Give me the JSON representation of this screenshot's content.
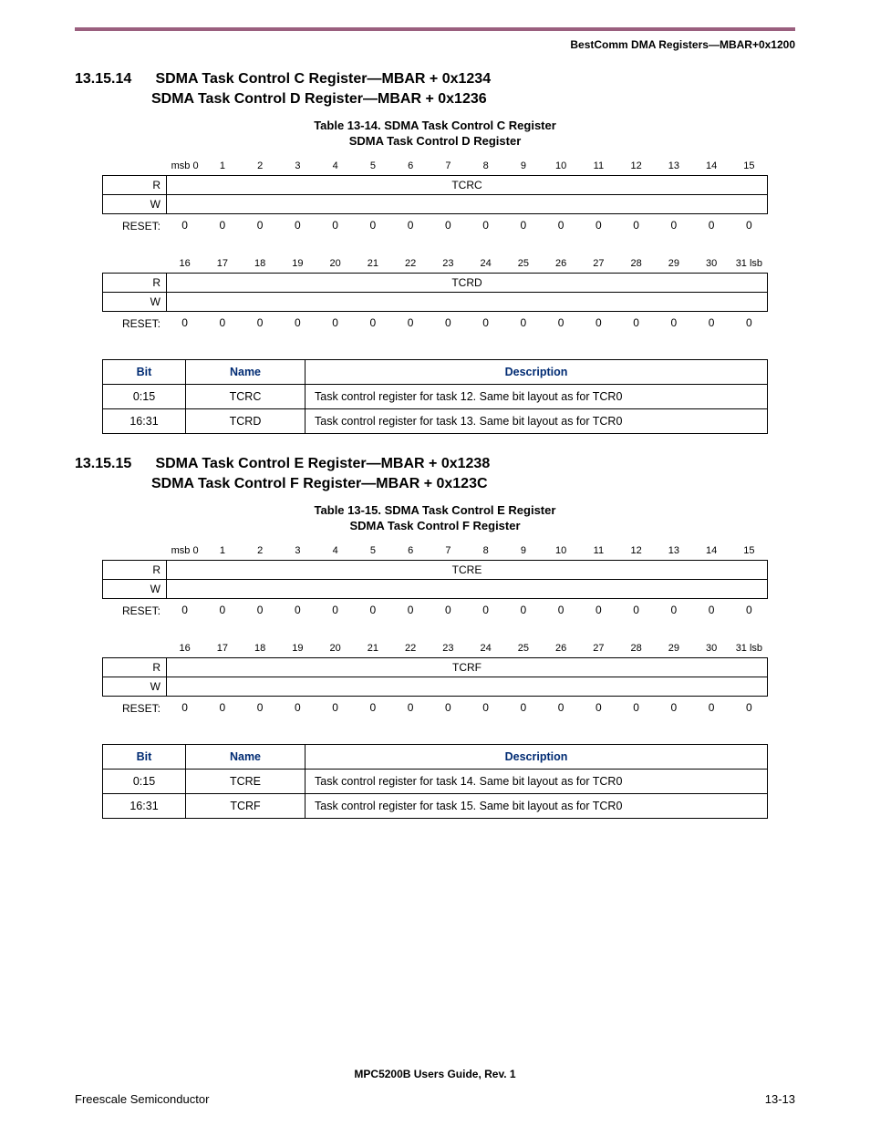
{
  "running_header": "BestComm DMA Registers—MBAR+0x1200",
  "footer_center": "MPC5200B Users Guide, Rev. 1",
  "footer_left": "Freescale Semiconductor",
  "footer_right": "13-13",
  "section1": {
    "number": "13.15.14",
    "line1": "SDMA Task Control C Register—MBAR + 0x1234",
    "line2": "SDMA Task Control D Register—MBAR + 0x1236",
    "caption_line1": "Table 13-14. SDMA Task Control C Register",
    "caption_line2": "SDMA Task Control D Register",
    "layout": {
      "row1_headers": [
        "msb 0",
        "1",
        "2",
        "3",
        "4",
        "5",
        "6",
        "7",
        "8",
        "9",
        "10",
        "11",
        "12",
        "13",
        "14",
        "15"
      ],
      "row1_field": "TCRC",
      "row1_reset": [
        "0",
        "0",
        "0",
        "0",
        "0",
        "0",
        "0",
        "0",
        "0",
        "0",
        "0",
        "0",
        "0",
        "0",
        "0",
        "0"
      ],
      "row2_headers": [
        "16",
        "17",
        "18",
        "19",
        "20",
        "21",
        "22",
        "23",
        "24",
        "25",
        "26",
        "27",
        "28",
        "29",
        "30",
        "31 lsb"
      ],
      "row2_field": "TCRD",
      "row2_reset": [
        "0",
        "0",
        "0",
        "0",
        "0",
        "0",
        "0",
        "0",
        "0",
        "0",
        "0",
        "0",
        "0",
        "0",
        "0",
        "0"
      ],
      "label_R": "R",
      "label_W": "W",
      "label_reset": "RESET:"
    },
    "desc": {
      "headers": {
        "bit": "Bit",
        "name": "Name",
        "desc": "Description"
      },
      "rows": [
        {
          "bit": "0:15",
          "name": "TCRC",
          "desc": "Task control register for task 12. Same bit layout as for TCR0"
        },
        {
          "bit": "16:31",
          "name": "TCRD",
          "desc": "Task control register for task 13. Same bit layout as for TCR0"
        }
      ]
    }
  },
  "section2": {
    "number": "13.15.15",
    "line1": "SDMA Task Control E Register—MBAR + 0x1238",
    "line2": "SDMA Task Control F Register—MBAR + 0x123C",
    "caption_line1": "Table 13-15. SDMA Task Control E Register",
    "caption_line2": "SDMA Task Control F Register",
    "layout": {
      "row1_headers": [
        "msb 0",
        "1",
        "2",
        "3",
        "4",
        "5",
        "6",
        "7",
        "8",
        "9",
        "10",
        "11",
        "12",
        "13",
        "14",
        "15"
      ],
      "row1_field": "TCRE",
      "row1_reset": [
        "0",
        "0",
        "0",
        "0",
        "0",
        "0",
        "0",
        "0",
        "0",
        "0",
        "0",
        "0",
        "0",
        "0",
        "0",
        "0"
      ],
      "row2_headers": [
        "16",
        "17",
        "18",
        "19",
        "20",
        "21",
        "22",
        "23",
        "24",
        "25",
        "26",
        "27",
        "28",
        "29",
        "30",
        "31 lsb"
      ],
      "row2_field": "TCRF",
      "row2_reset": [
        "0",
        "0",
        "0",
        "0",
        "0",
        "0",
        "0",
        "0",
        "0",
        "0",
        "0",
        "0",
        "0",
        "0",
        "0",
        "0"
      ],
      "label_R": "R",
      "label_W": "W",
      "label_reset": "RESET:"
    },
    "desc": {
      "headers": {
        "bit": "Bit",
        "name": "Name",
        "desc": "Description"
      },
      "rows": [
        {
          "bit": "0:15",
          "name": "TCRE",
          "desc": "Task control register for task 14. Same bit layout as for TCR0"
        },
        {
          "bit": "16:31",
          "name": "TCRF",
          "desc": "Task control register for task 15. Same bit layout as for TCR0"
        }
      ]
    }
  }
}
